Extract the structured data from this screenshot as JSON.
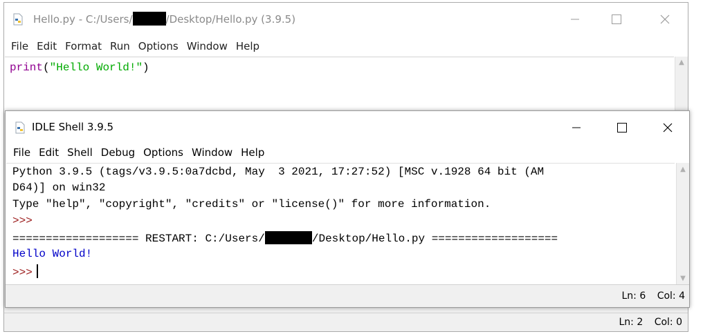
{
  "editor": {
    "title_prefix": "Hello.py - C:/Users/",
    "title_suffix": "/Desktop/Hello.py (3.9.5)",
    "menu": [
      "File",
      "Edit",
      "Format",
      "Run",
      "Options",
      "Window",
      "Help"
    ],
    "code": {
      "builtin": "print",
      "open": "(",
      "string": "\"Hello World!\"",
      "close": ")"
    },
    "status": {
      "ln": "Ln: 2",
      "col": "Col: 0"
    }
  },
  "shell": {
    "title": "IDLE Shell 3.9.5",
    "menu": [
      "File",
      "Edit",
      "Shell",
      "Debug",
      "Options",
      "Window",
      "Help"
    ],
    "lines": {
      "banner1": "Python 3.9.5 (tags/v3.9.5:0a7dcbd, May  3 2021, 17:27:52) [MSC v.1928 64 bit (AM",
      "banner2": "D64)] on win32",
      "banner3": "Type \"help\", \"copyright\", \"credits\" or \"license()\" for more information.",
      "prompt1": ">>>",
      "restart_prefix": "=================== RESTART: C:/Users/",
      "restart_suffix": "/Desktop/Hello.py ===================",
      "output": "Hello World!",
      "prompt2": ">>>"
    },
    "status": {
      "ln": "Ln: 6",
      "col": "Col: 4"
    }
  },
  "icons": {
    "app": "python-file-icon",
    "minimize": "minimize-icon",
    "maximize": "maximize-icon",
    "close": "close-icon",
    "scroll_up": "scroll-up-arrow-icon",
    "scroll_down": "scroll-down-arrow-icon"
  },
  "colors": {
    "builtin": "#900090",
    "string": "#00aa00",
    "prompt": "#9c1c1c",
    "stdout": "#0000c8"
  }
}
